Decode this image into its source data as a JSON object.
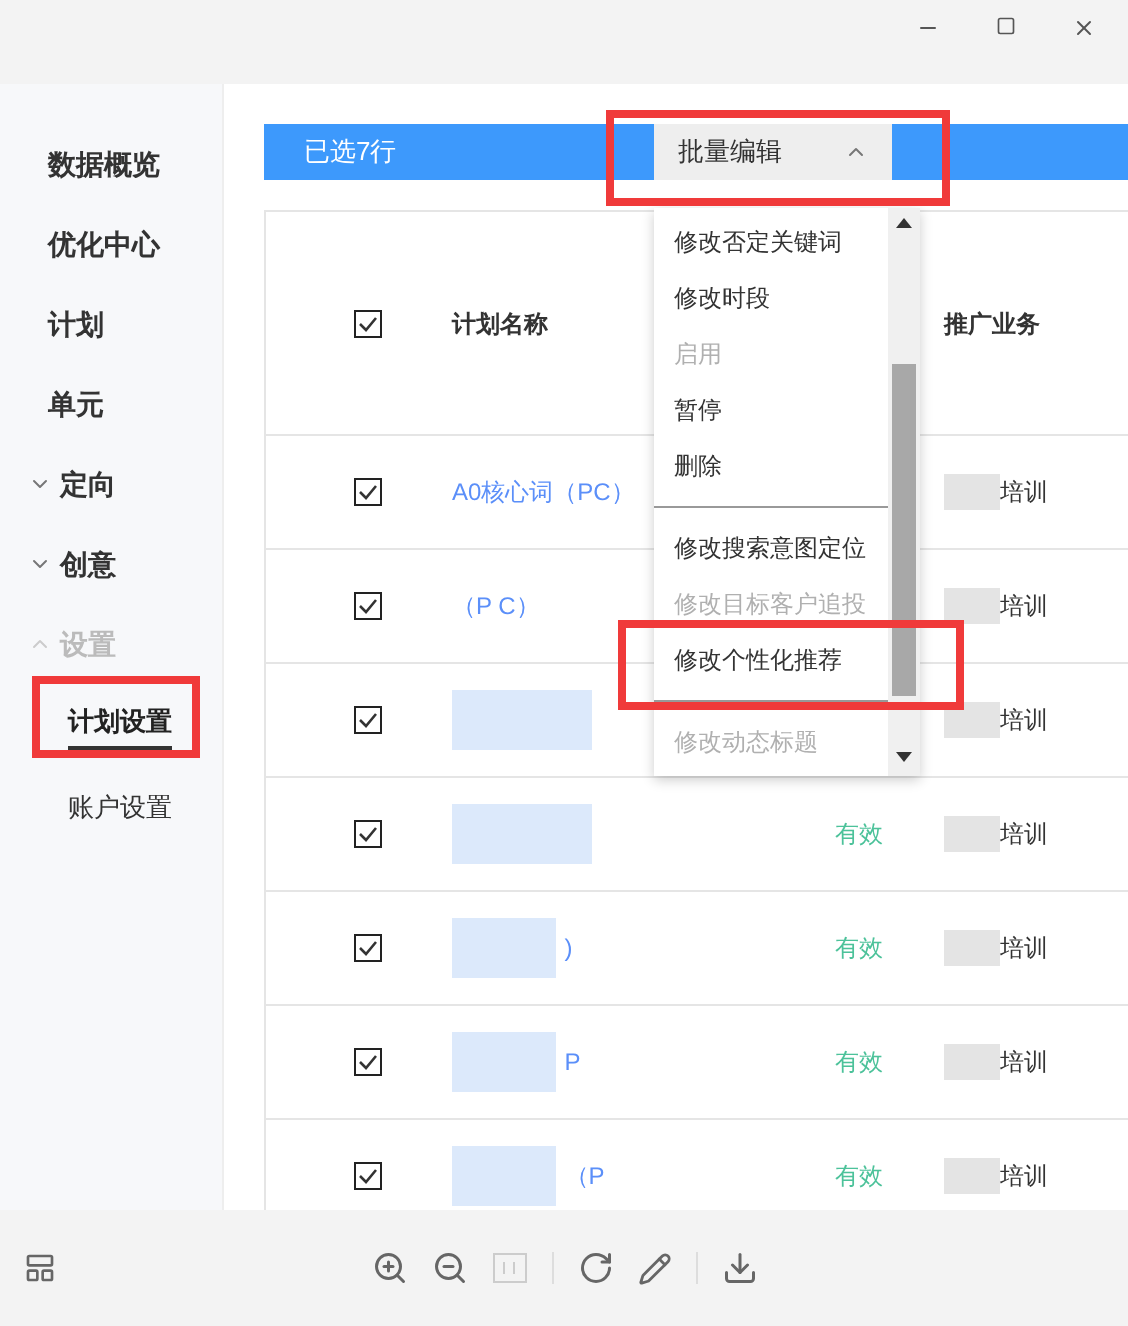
{
  "sidebar": {
    "items": [
      {
        "label": "数据概览",
        "kind": "plain"
      },
      {
        "label": "优化中心",
        "kind": "plain"
      },
      {
        "label": "计划",
        "kind": "plain"
      },
      {
        "label": "单元",
        "kind": "plain"
      },
      {
        "label": "定向",
        "kind": "group",
        "expanded": false,
        "disabled": false
      },
      {
        "label": "创意",
        "kind": "group",
        "expanded": false,
        "disabled": false
      },
      {
        "label": "设置",
        "kind": "group",
        "expanded": true,
        "disabled": true,
        "children": [
          {
            "label": "计划设置",
            "selected": true
          },
          {
            "label": "账户设置",
            "selected": false
          }
        ]
      }
    ]
  },
  "selection_bar": {
    "text": "已选7行",
    "dropdown": {
      "label": "批量编辑",
      "expanded": true
    }
  },
  "menu": {
    "items": [
      {
        "kind": "item",
        "label": "修改否定关键词",
        "disabled": false
      },
      {
        "kind": "item",
        "label": "修改时段",
        "disabled": false
      },
      {
        "kind": "item",
        "label": "启用",
        "disabled": true
      },
      {
        "kind": "item",
        "label": "暂停",
        "disabled": false
      },
      {
        "kind": "item",
        "label": "删除",
        "disabled": false
      },
      {
        "kind": "divider"
      },
      {
        "kind": "item",
        "label": "修改搜索意图定位",
        "disabled": false
      },
      {
        "kind": "item",
        "label": "修改目标客户追投",
        "disabled": true
      },
      {
        "kind": "item",
        "label": "修改个性化推荐",
        "disabled": false
      },
      {
        "kind": "divider"
      },
      {
        "kind": "item",
        "label": "修改动态标题",
        "disabled": true
      }
    ]
  },
  "table": {
    "columns": [
      "计划名称",
      "推广业务"
    ],
    "all_checked": true,
    "rows": [
      {
        "checked": true,
        "name": "A0核心词（PC）",
        "business": "培训"
      },
      {
        "checked": true,
        "name": "（P C）",
        "business": "培训"
      },
      {
        "checked": true,
        "business": "培训"
      },
      {
        "checked": true,
        "status": "有效",
        "business": "培训"
      },
      {
        "checked": true,
        "name": ")",
        "status": "有效",
        "business": "培训"
      },
      {
        "checked": true,
        "name": "P",
        "status": "有效",
        "business": "培训"
      },
      {
        "checked": true,
        "name": "（P",
        "status": "有效",
        "business": "培训"
      }
    ]
  }
}
